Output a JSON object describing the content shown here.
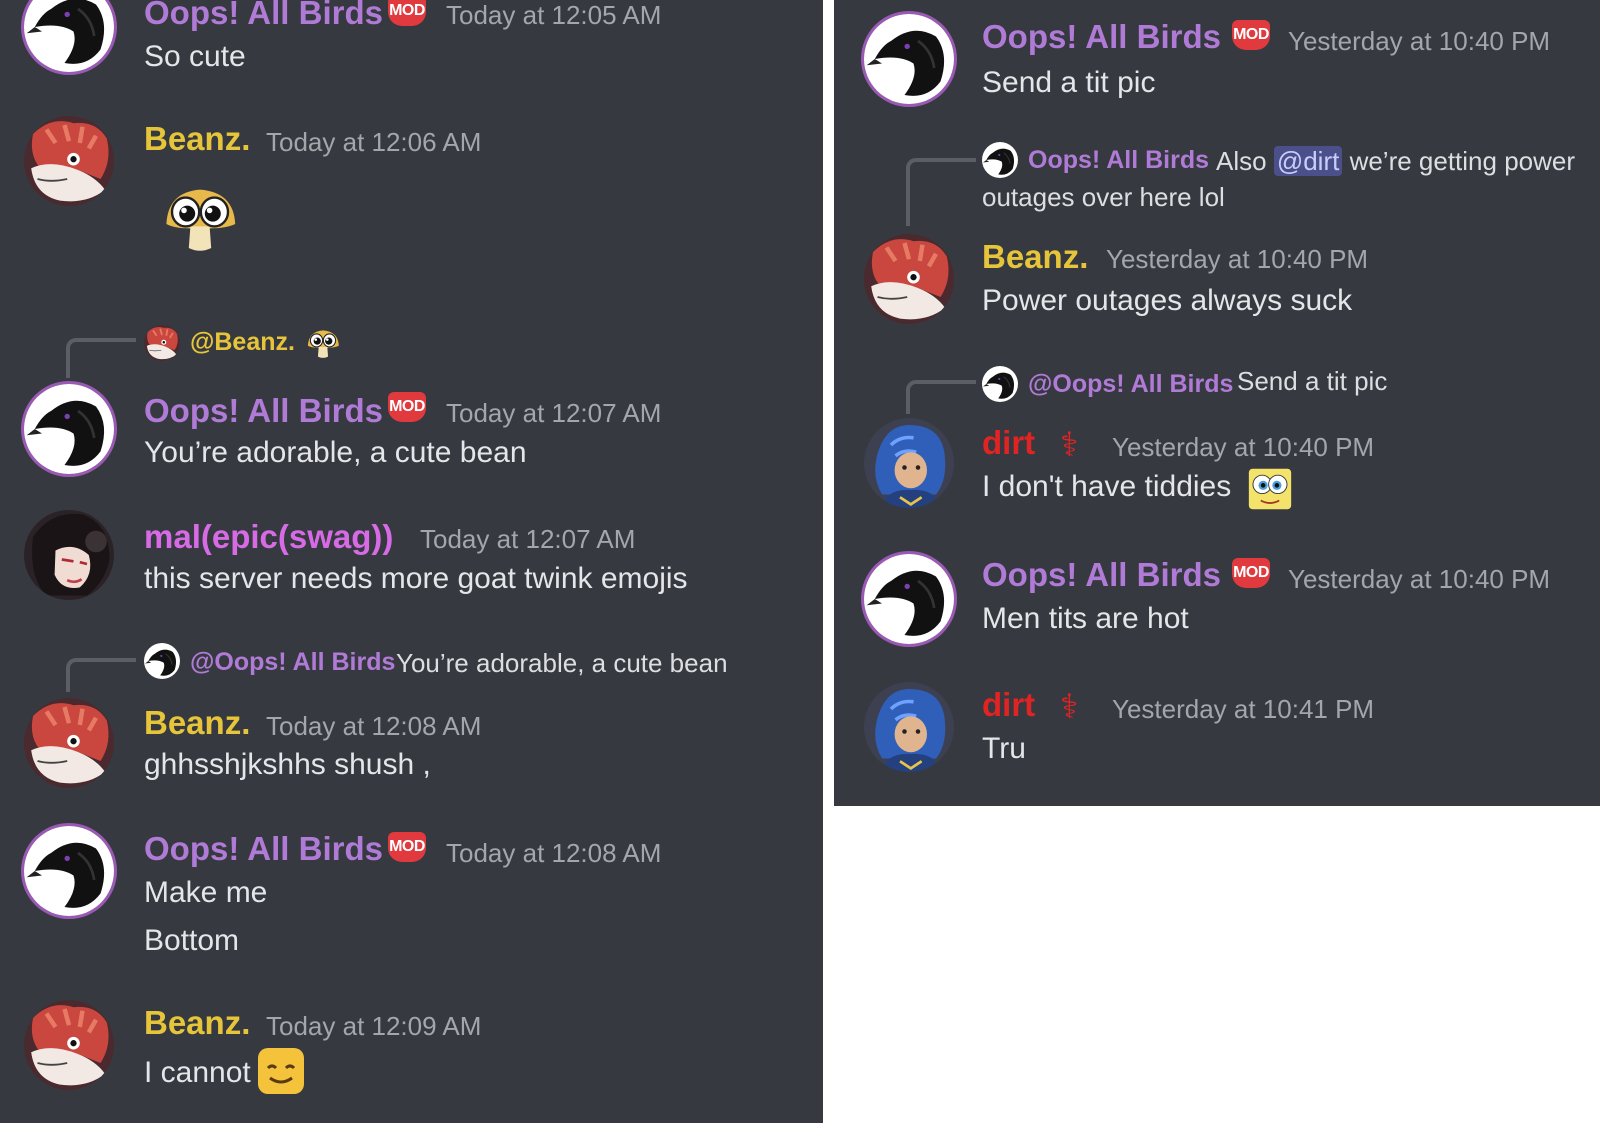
{
  "left_panel": {
    "messages": [
      {
        "author": "Oops! All Birds",
        "badge": "MOD",
        "timestamp": "Today at 12:05 AM",
        "lines": [
          "So cute"
        ]
      },
      {
        "author": "Beanz.",
        "timestamp": "Today at 12:06 AM",
        "lines": [],
        "attachment_emoji": "mushroom-big-eyes-emoji"
      },
      {
        "reply": {
          "mention": "@Beanz.",
          "emoji": "mushroom-big-eyes-emoji"
        },
        "author": "Oops! All Birds",
        "badge": "MOD",
        "timestamp": "Today at 12:07 AM",
        "lines": [
          "You’re adorable, a cute bean"
        ]
      },
      {
        "author": "mal(epic(swag))",
        "timestamp": "Today at 12:07 AM",
        "lines": [
          "this server needs more goat twink emojis"
        ]
      },
      {
        "reply": {
          "mention": "@Oops! All Birds",
          "text": "You’re adorable, a cute bean"
        },
        "author": "Beanz.",
        "timestamp": "Today at 12:08 AM",
        "lines": [
          "ghhsshjkshhs shush ,"
        ]
      },
      {
        "author": "Oops! All Birds",
        "badge": "MOD",
        "timestamp": "Today at 12:08 AM",
        "lines": [
          "Make me",
          "Bottom"
        ]
      },
      {
        "author": "Beanz.",
        "timestamp": "Today at 12:09 AM",
        "lines": [
          "I cannot"
        ],
        "trailing_emoji": "smiling-face-emoji"
      }
    ]
  },
  "right_panel": {
    "messages": [
      {
        "author": "Oops! All Birds",
        "badge": "MOD",
        "timestamp": "Yesterday at 10:40 PM",
        "lines": [
          "Send a tit pic"
        ]
      },
      {
        "reply": {
          "author": "Oops! All Birds",
          "text_before": "Also",
          "mention": "@dirt",
          "text_after": "we’re getting power",
          "text_line2": "outages over here lol"
        },
        "author": "Beanz.",
        "timestamp": "Yesterday at 10:40 PM",
        "lines": [
          "Power outages always suck"
        ]
      },
      {
        "reply": {
          "mention": "@Oops! All Birds",
          "text": "Send a tit pic"
        },
        "author": "dirt",
        "role_icon": "red-role-icon",
        "timestamp": "Yesterday at 10:40 PM",
        "lines": [
          "I don't have tiddies"
        ],
        "trailing_emoji": "spongebob-eyes-emoji"
      },
      {
        "author": "Oops! All Birds",
        "badge": "MOD",
        "timestamp": "Yesterday at 10:40 PM",
        "lines": [
          "Men tits are hot"
        ]
      },
      {
        "author": "dirt",
        "role_icon": "red-role-icon",
        "timestamp": "Yesterday at 10:41 PM",
        "lines": [
          "Tru"
        ]
      }
    ]
  },
  "colors": {
    "background": "#36393f",
    "birds_name": "#b07bd6",
    "beanz_name": "#e7c53a",
    "mal_name": "#d76be6",
    "dirt_name": "#e02424",
    "mod_badge": "#e03a3e",
    "timestamp": "#a3a6aa",
    "message_text": "#e4e6e9"
  }
}
